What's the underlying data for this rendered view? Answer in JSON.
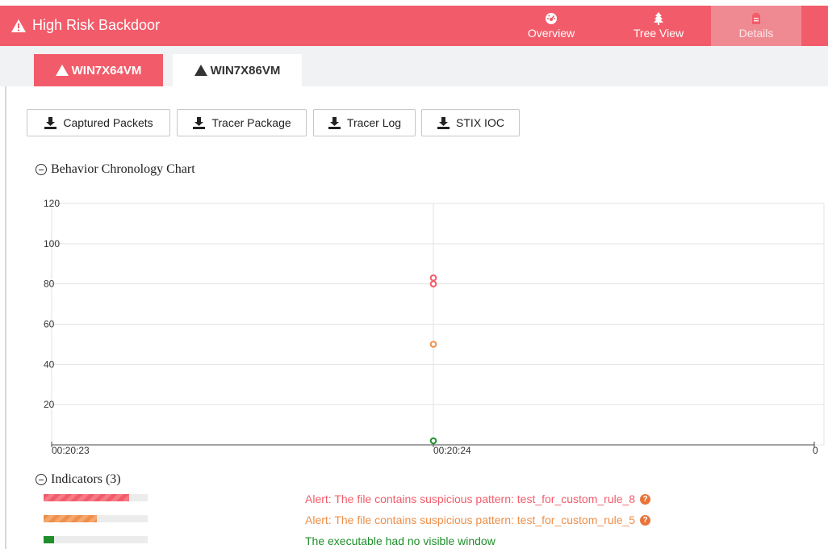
{
  "header": {
    "title": "High Risk Backdoor",
    "title_icon": "warning-triangle-icon",
    "color": "#f25c6a",
    "nav": [
      {
        "label": "Overview",
        "icon": "dashboard-icon"
      },
      {
        "label": "Tree View",
        "icon": "tree-icon"
      },
      {
        "label": "Details",
        "icon": "details-icon",
        "active": true
      }
    ]
  },
  "hosts": [
    {
      "label": "WIN7X64VM",
      "active": true
    },
    {
      "label": "WIN7X86VM",
      "active": false
    }
  ],
  "downloads": [
    {
      "label": "Captured Packets",
      "icon": "download-icon"
    },
    {
      "label": "Tracer Package",
      "icon": "download-icon"
    },
    {
      "label": "Tracer Log",
      "icon": "download-icon"
    },
    {
      "label": "STIX IOC",
      "icon": "download-icon"
    }
  ],
  "chart_section": {
    "title": "Behavior Chronology Chart"
  },
  "chart_data": {
    "type": "scatter",
    "title": "",
    "xlabel": "",
    "ylabel": "",
    "ylim": [
      0,
      120
    ],
    "yticks": [
      "120",
      "100",
      "80",
      "60",
      "40",
      "20"
    ],
    "xticks": [
      "00:20:23",
      "00:20:24",
      "0"
    ],
    "grid": true,
    "series": [
      {
        "color": "#f25c6a",
        "points": [
          {
            "x": "00:20:24",
            "y": 83
          },
          {
            "x": "00:20:24",
            "y": 80
          }
        ]
      },
      {
        "color": "#ef8f4a",
        "points": [
          {
            "x": "00:20:24",
            "y": 50
          }
        ]
      },
      {
        "color": "#1e8f2a",
        "points": [
          {
            "x": "00:20:24",
            "y": 2
          }
        ]
      }
    ]
  },
  "indicators": {
    "title": "Indicators (3)",
    "items": [
      {
        "text": "Alert: The file contains suspicious pattern: test_for_custom_rule_8",
        "level": 0.82,
        "color": "#f25c6a",
        "help": true
      },
      {
        "text": "Alert: The file contains suspicious pattern: test_for_custom_rule_5",
        "level": 0.51,
        "color": "#ef8f4a",
        "help": true
      },
      {
        "text": "The executable had no visible window",
        "level": 0.1,
        "color": "#1e8f2a",
        "help": false
      }
    ]
  }
}
